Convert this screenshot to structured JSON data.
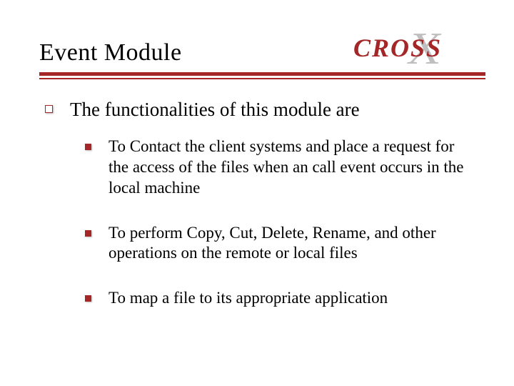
{
  "header": {
    "title": "Event Module",
    "logo_text": "CROSS"
  },
  "content": {
    "main": "The functionalities of this module are",
    "items": [
      "To Contact the client systems and place a request for the access of the files when an call event occurs in the local machine",
      "To perform Copy, Cut, Delete, Rename, and other operations on the remote or local files",
      "To map a file to its appropriate application"
    ]
  },
  "colors": {
    "accent": "#a42626"
  }
}
